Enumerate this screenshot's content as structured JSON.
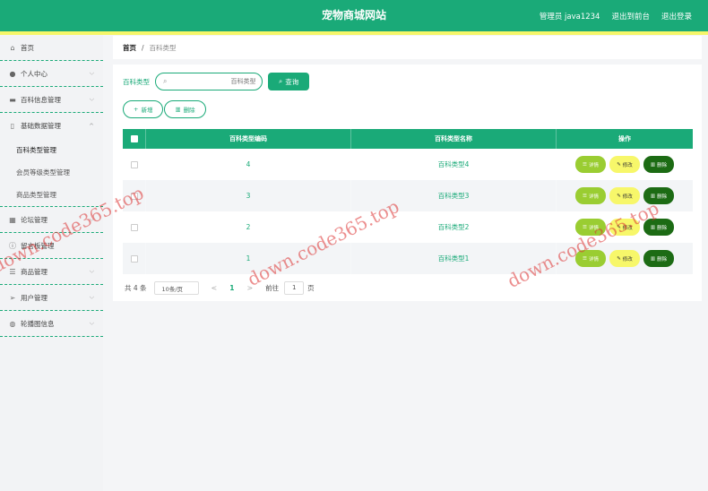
{
  "header": {
    "title": "宠物商城网站",
    "user_label": "管理员 java1234",
    "back_link": "退出到前台",
    "logout_link": "退出登录"
  },
  "sidebar": {
    "items": [
      {
        "label": "首页",
        "icon": "home-icon"
      },
      {
        "label": "个人中心",
        "icon": "user-icon"
      },
      {
        "label": "百科信息管理",
        "icon": "folder-icon"
      },
      {
        "label": "基础数据管理",
        "icon": "document-icon",
        "expanded": true,
        "children": [
          "百科类型管理",
          "会员等级类型管理",
          "商品类型管理"
        ]
      },
      {
        "label": "论坛管理",
        "icon": "grid-icon"
      },
      {
        "label": "留言板管理",
        "icon": "info-icon"
      },
      {
        "label": "商品管理",
        "icon": "list-icon"
      },
      {
        "label": "用户管理",
        "icon": "send-icon"
      },
      {
        "label": "轮播图信息",
        "icon": "globe-icon"
      }
    ]
  },
  "breadcrumb": {
    "home": "首页",
    "sep": "/",
    "current": "百科类型"
  },
  "search": {
    "label": "百科类型",
    "placeholder": "百科类型",
    "button": "查询"
  },
  "actions": {
    "add": "新增",
    "delete": "删除"
  },
  "table": {
    "headers": {
      "code": "百科类型编码",
      "name": "百科类型名称",
      "ops": "操作"
    },
    "rows": [
      {
        "code": "4",
        "name": "百科类型4"
      },
      {
        "code": "3",
        "name": "百科类型3"
      },
      {
        "code": "2",
        "name": "百科类型2"
      },
      {
        "code": "1",
        "name": "百科类型1"
      }
    ],
    "op_labels": {
      "detail": "详情",
      "edit": "修改",
      "delete": "删除"
    }
  },
  "pager": {
    "total": "共 4 条",
    "page_size": "10条/页",
    "prev": "<",
    "current_page": "1",
    "next": ">",
    "goto_label": "前往",
    "goto_value": "1",
    "page_suffix": "页"
  },
  "watermark": "down.code365.top",
  "colors": {
    "primary": "#1aaa78",
    "accent_yellow": "#f6f66a",
    "detail_btn": "#9acd32",
    "edit_btn": "#f7f76a",
    "delete_btn": "#1c6b14"
  }
}
